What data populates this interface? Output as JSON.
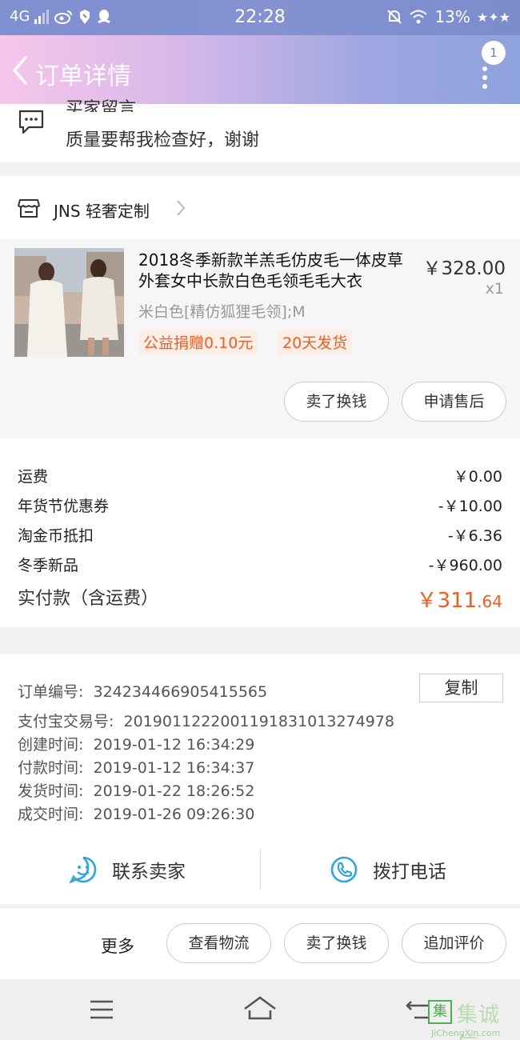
{
  "status_bar": {
    "network": "4G",
    "time": "22:28",
    "battery": "13%"
  },
  "header": {
    "title": "订单详情",
    "notification_count": "1"
  },
  "buyer_message": {
    "label_partial": "买家留言",
    "text": "质量要帮我检查好，谢谢"
  },
  "shop": {
    "name": "JNS 轻奢定制"
  },
  "product": {
    "title": "2018冬季新款羊羔毛仿皮毛一体皮草外套女中长款白色毛领毛毛大衣",
    "price": "￥328.00",
    "quantity": "x1",
    "sku": "米白色[精仿狐狸毛领];M",
    "tags": [
      "公益捐赠0.10元",
      "20天发货"
    ],
    "buttons": [
      "卖了换钱",
      "申请售后"
    ]
  },
  "costs": {
    "rows": [
      {
        "label": "运费",
        "value": "￥0.00"
      },
      {
        "label": "年货节优惠券",
        "value": "-￥10.00"
      },
      {
        "label": "淘金币抵扣",
        "value": "-￥6.36"
      },
      {
        "label": "冬季新品",
        "value": "-￥960.00"
      }
    ],
    "total_label": "实付款（含运费）",
    "total_main": "￥311",
    "total_cents": ".64"
  },
  "order_info": {
    "copy_button": "复制",
    "rows": [
      {
        "label": "订单编号:",
        "value": "324234466905415565"
      },
      {
        "label": "支付宝交易号:",
        "value": "2019011222001191831013274978"
      },
      {
        "label": "创建时间:",
        "value": "2019-01-12 16:34:29"
      },
      {
        "label": "付款时间:",
        "value": "2019-01-12 16:34:37"
      },
      {
        "label": "发货时间:",
        "value": "2019-01-22 18:26:52"
      },
      {
        "label": "成交时间:",
        "value": "2019-01-26 09:26:30"
      }
    ],
    "contact_seller": "联系卖家",
    "call_phone": "拨打电话"
  },
  "actions": {
    "more": "更多",
    "buttons": [
      "查看物流",
      "卖了换钱",
      "追加评价"
    ]
  },
  "watermark": {
    "cn": "集诚信",
    "url": "JiChengXin.com"
  },
  "colors": {
    "accent_orange": "#f25d22",
    "icon_blue": "#2ea7e0"
  }
}
